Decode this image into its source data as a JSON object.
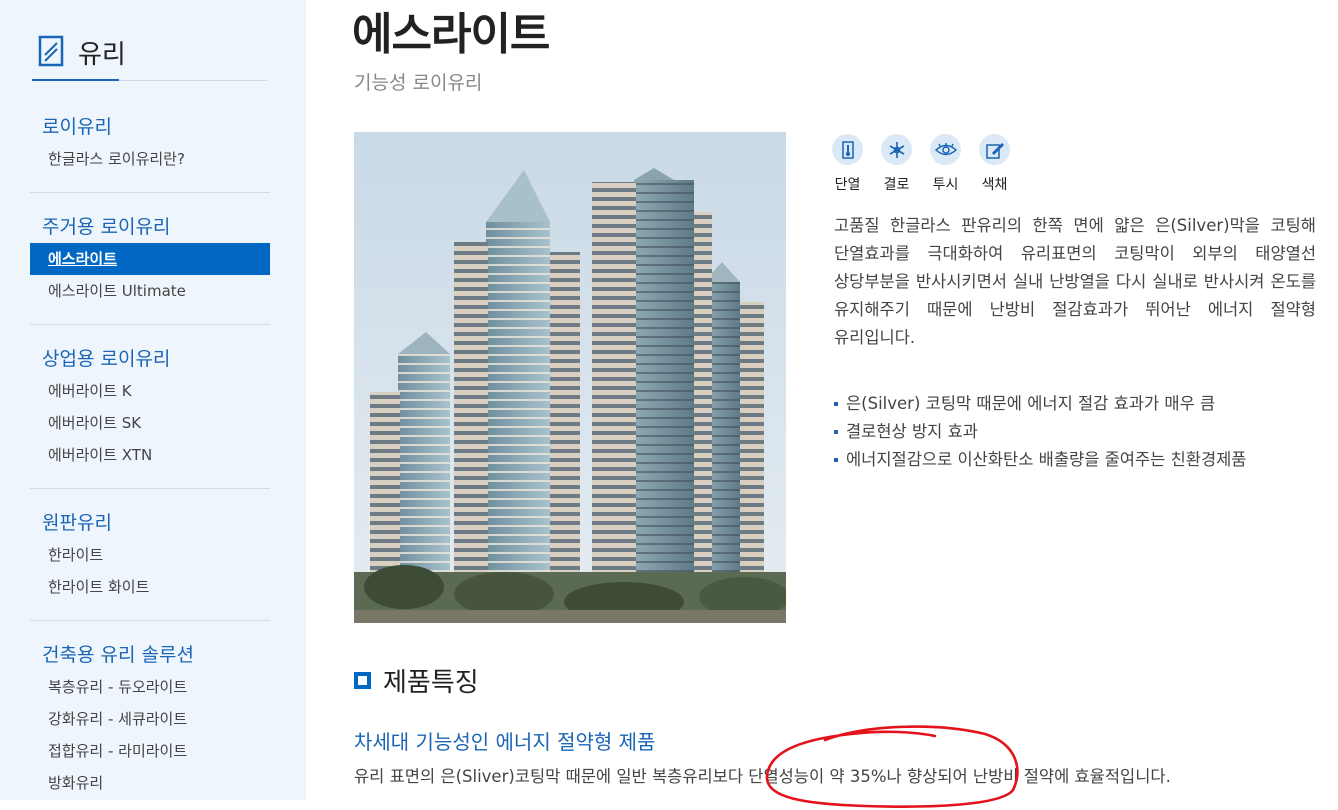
{
  "sidebar": {
    "title": "유리",
    "sections": [
      {
        "category": "로이유리",
        "items": [
          "한글라스 로이유리란?"
        ]
      },
      {
        "category": "주거용 로이유리",
        "items": [
          "에스라이트",
          "에스라이트 Ultimate"
        ]
      },
      {
        "category": "상업용 로이유리",
        "items": [
          "에버라이트 K",
          "에버라이트 SK",
          "에버라이트 XTN"
        ]
      },
      {
        "category": "원판유리",
        "items": [
          "한라이트",
          "한라이트 화이트"
        ]
      },
      {
        "category": "건축용 유리 솔루션",
        "items": [
          "복층유리 - 듀오라이트",
          "강화유리 - 세큐라이트",
          "접합유리 - 라미라이트",
          "방화유리"
        ]
      }
    ],
    "active_item": "에스라이트"
  },
  "main": {
    "title": "에스라이트",
    "subtitle": "기능성 로이유리",
    "features": [
      {
        "label": "단열",
        "icon": "thermometer-icon"
      },
      {
        "label": "결로",
        "icon": "snowflake-icon"
      },
      {
        "label": "투시",
        "icon": "eye-icon"
      },
      {
        "label": "색채",
        "icon": "brush-icon"
      }
    ],
    "description": "고품질 한글라스 판유리의 한쪽 면에 얇은 은(Silver)막을 코팅해 단열효과를 극대화하여 유리표면의 코팅막이 외부의 태양열선 상당부분을 반사시키면서 실내 난방열을 다시 실내로 반사시켜 온도를 유지해주기 때문에 난방비 절감효과가 뛰어난 에너지 절약형 유리입니다.",
    "bullets": [
      "은(Silver) 코팅막 때문에 에너지 절감 효과가 매우 큼",
      "결로현상 방지 효과",
      "에너지절감으로 이산화탄소 배출량을 줄여주는 친환경제품"
    ],
    "features_heading": "제품특징",
    "features_subheading": "차세대 기능성인 에너지 절약형 제품",
    "features_text": "유리 표면의 은(Sliver)코팅막 때문에 일반 복층유리보다 단열성능이 약 35%나 향상되어 난방비 절약에 효율적입니다."
  },
  "colors": {
    "accent": "#1a65b5",
    "active_bg": "#0068c2",
    "sidebar_bg": "#eef5fc",
    "annotation": "#e3121b"
  }
}
